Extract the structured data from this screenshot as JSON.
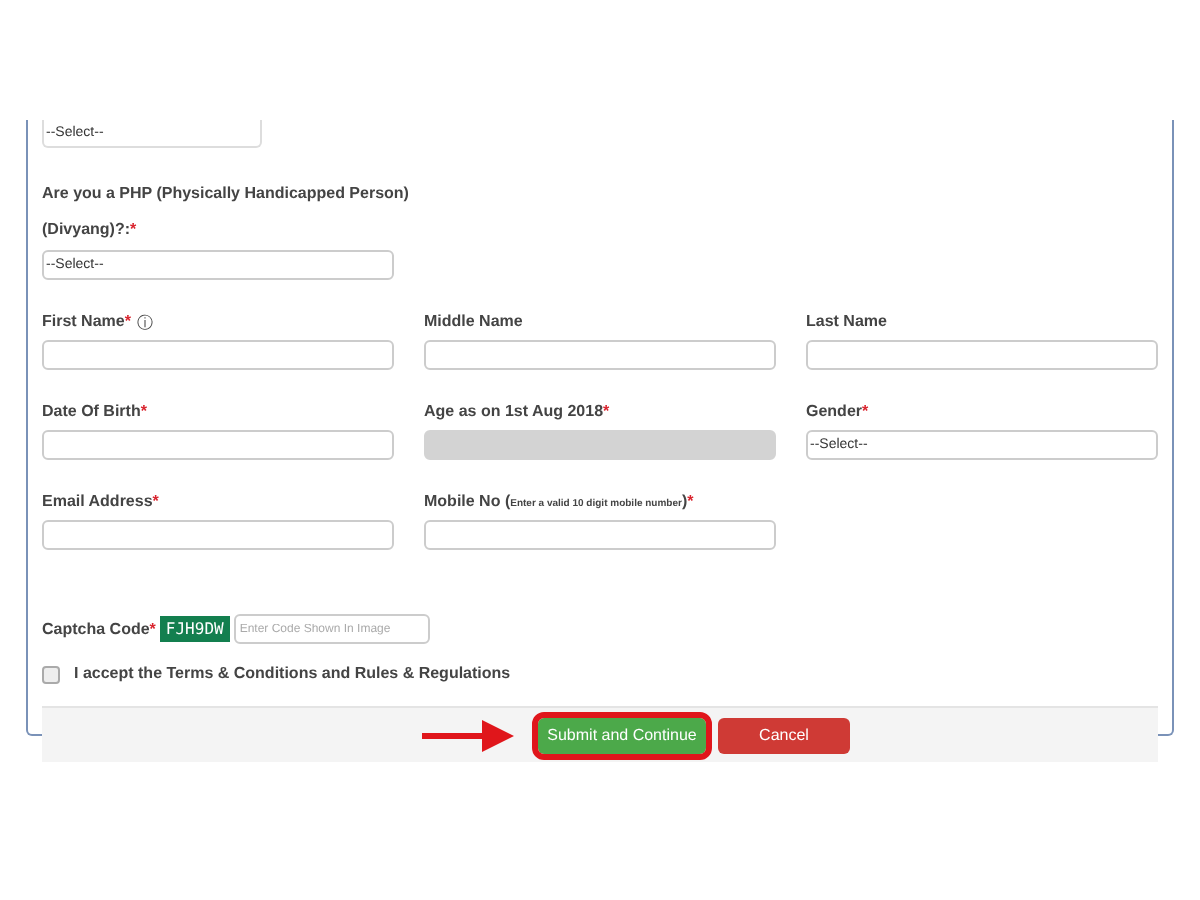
{
  "top_select": {
    "value": "--Select--"
  },
  "php": {
    "label": "Are you a PHP (Physically Handicapped Person) (Divyang)?:",
    "mark": "*",
    "value": "--Select--"
  },
  "rows": [
    {
      "fields": [
        {
          "label": "First Name",
          "mark": "*",
          "info": "ⓘ",
          "kind": "text"
        },
        {
          "label": "Middle Name",
          "kind": "text"
        },
        {
          "label": "Last Name",
          "kind": "text"
        }
      ]
    },
    {
      "fields": [
        {
          "label": "Date Of Birth",
          "mark": "*",
          "kind": "text"
        },
        {
          "label": "Age as on 1st Aug 2018",
          "mark": "*",
          "kind": "disabled"
        },
        {
          "label": "Gender",
          "mark": "*",
          "kind": "select",
          "value": "--Select--"
        }
      ]
    },
    {
      "fields": [
        {
          "label": "Email Address",
          "mark": "*",
          "kind": "text"
        },
        {
          "label": "Mobile No (",
          "hint": "Enter a valid 10 digit mobile number",
          "label_end": ")",
          "mark": "*",
          "kind": "text"
        }
      ]
    }
  ],
  "captcha": {
    "label": "Captcha Code",
    "mark": "*",
    "code": "FJH9DW",
    "placeholder": "Enter Code Shown In Image"
  },
  "terms": {
    "label": "I accept the Terms & Conditions and Rules & Regulations",
    "checked": false
  },
  "buttons": [
    {
      "label": "Submit and Continue",
      "kind": "primary",
      "highlighted": true
    },
    {
      "label": "Cancel",
      "kind": "danger",
      "highlighted": false
    }
  ]
}
